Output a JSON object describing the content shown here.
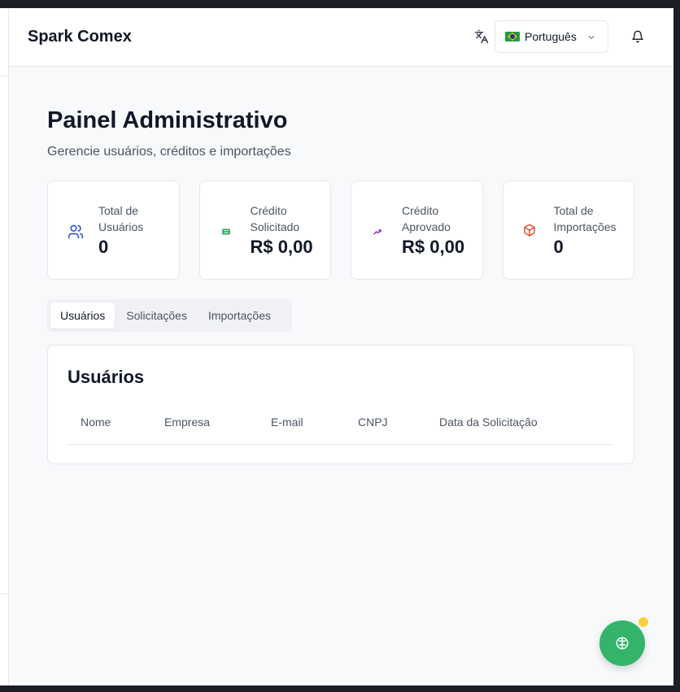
{
  "header": {
    "brand": "Spark Comex",
    "language": {
      "selected": "Português",
      "flag": "brazil-flag"
    },
    "icons": [
      "translate-icon",
      "chevron-down-icon",
      "bell-icon"
    ]
  },
  "page": {
    "title": "Painel Administrativo",
    "subtitle": "Gerencie usuários, créditos e importações"
  },
  "stats": [
    {
      "label": "Total de Usuários",
      "value": "0",
      "icon": "users-icon",
      "color": "#3b5bdb"
    },
    {
      "label": "Crédito Solicitado",
      "value": "R$ 0,00",
      "icon": "credit-card-icon",
      "color": "#22a35a"
    },
    {
      "label": "Crédito Aprovado",
      "value": "R$ 0,00",
      "icon": "trending-up-icon",
      "color": "#9b3fd1"
    },
    {
      "label": "Total de Importações",
      "value": "0",
      "icon": "package-icon",
      "color": "#e0431b"
    }
  ],
  "tabs": [
    {
      "label": "Usuários",
      "active": true
    },
    {
      "label": "Solicitações",
      "active": false
    },
    {
      "label": "Importações",
      "active": false
    }
  ],
  "panel": {
    "title": "Usuários",
    "columns": [
      "Nome",
      "Empresa",
      "E-mail",
      "CNPJ",
      "Data da Solicitação"
    ]
  },
  "fab": {
    "icon": "brain-icon",
    "color": "#34b36b",
    "badge_color": "#f6d33c"
  }
}
